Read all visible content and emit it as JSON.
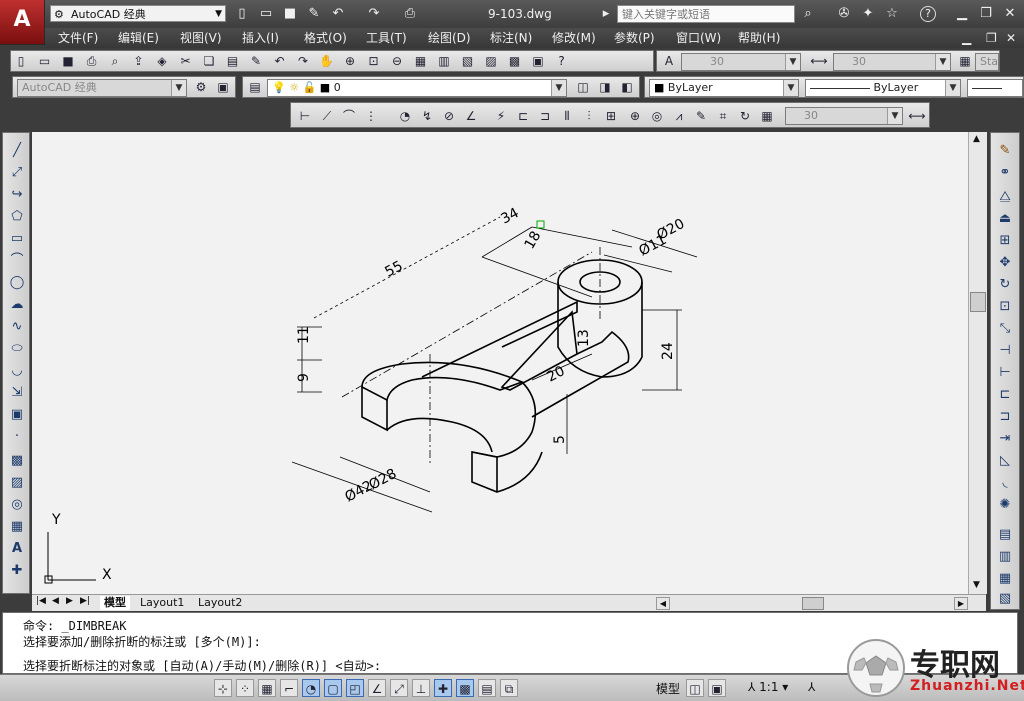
{
  "app": {
    "logo_letter": "A",
    "workspace": "AutoCAD 经典",
    "document_title": "9-103.dwg",
    "help_search_placeholder": "键入关键字或短语",
    "help_label": "?"
  },
  "menus": [
    "文件(F)",
    "编辑(E)",
    "视图(V)",
    "插入(I)",
    "格式(O)",
    "工具(T)",
    "绘图(D)",
    "标注(N)",
    "修改(M)",
    "参数(P)",
    "窗口(W)",
    "帮助(H)"
  ],
  "toolbars": {
    "text_height_1": "30",
    "text_height_2": "30",
    "text_style": "Standa",
    "workspace_combo": "AutoCAD 经典",
    "layer_combo": "0",
    "color_combo": "ByLayer",
    "linetype_combo": "ByLayer",
    "lineweight_combo": "ByLayer",
    "dim_scale": "30"
  },
  "drawing": {
    "dimensions": {
      "d55": "55",
      "d11": "11",
      "d9": "9",
      "d13": "13",
      "d5": "5",
      "d18": "18",
      "d24": "24",
      "d20": "20",
      "dia20": "Ø20",
      "dia11": "Ø11",
      "dia28": "Ø28",
      "dia42": "Ø42",
      "d34": "34"
    },
    "ucs_x": "X",
    "ucs_y": "Y"
  },
  "tabs": [
    "模型",
    "Layout1",
    "Layout2"
  ],
  "command": {
    "line1": "命令:  _DIMBREAK",
    "line2": "选择要添加/删除折断的标注或 [多个(M)]:",
    "line3": "选择要折断标注的对象或 [自动(A)/手动(M)/删除(R)] <自动>:"
  },
  "status": {
    "model_label": "模型",
    "annotation_scale": "1:1"
  },
  "watermark": {
    "brand_cn": "专职网",
    "brand_url": "Zhuanzhi.Net"
  },
  "colors": {
    "logo_red": "#b52222",
    "title_bar": "#4a4a4a",
    "canvas": "#f2f2f2"
  }
}
